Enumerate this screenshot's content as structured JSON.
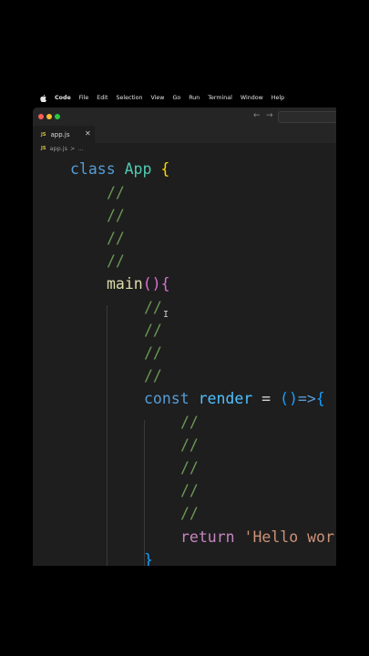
{
  "menubar": {
    "app_name": "Code",
    "items": [
      "File",
      "Edit",
      "Selection",
      "View",
      "Go",
      "Run",
      "Terminal",
      "Window",
      "Help"
    ]
  },
  "icons": {
    "apple": "apple-icon",
    "back": "arrow-left-icon",
    "forward": "arrow-right-icon",
    "close": "close-icon"
  },
  "colors": {
    "editor_bg": "#1e1e1e",
    "keyword": "#569cd6",
    "class_name": "#4ec9b0",
    "function": "#dcdcaa",
    "comment": "#6a9955",
    "string": "#ce9178",
    "return": "#c586c0"
  },
  "titlebar": {
    "back_glyph": "←",
    "forward_glyph": "→"
  },
  "tab": {
    "badge": "JS",
    "filename": "app.js",
    "close_glyph": "✕"
  },
  "breadcrumb": {
    "badge": "JS",
    "file": "app.js",
    "separator": ">",
    "more": "..."
  },
  "code": {
    "class_kw": "class",
    "class_name": "App",
    "open_brace": "{",
    "comment": "//",
    "method_name": "main",
    "method_parens": "()",
    "const_kw": "const",
    "var_name": "render",
    "equals": "=",
    "arrow_parens": "()",
    "arrow": "=>",
    "return_kw": "return",
    "return_value": "'Hello wor",
    "close_brace": "}"
  }
}
